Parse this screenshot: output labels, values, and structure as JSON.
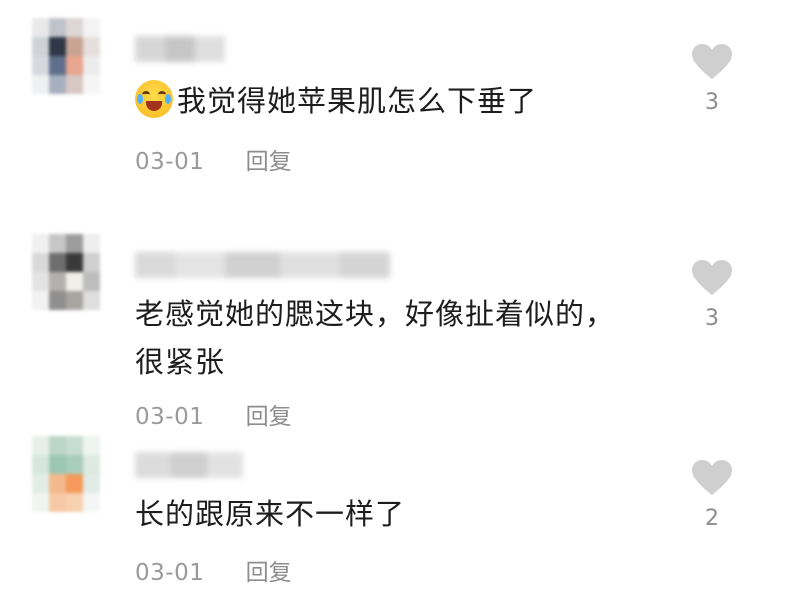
{
  "comments": [
    {
      "text_prefix_emoji": "laughing-crying-emoji",
      "text": "我觉得她苹果肌怎么下垂了",
      "date": "03-01",
      "reply_label": "回复",
      "likes": "3"
    },
    {
      "text": "老感觉她的腮这块，好像扯着似的，",
      "text_line2": "很紧张",
      "date": "03-01",
      "reply_label": "回复",
      "likes": "3"
    },
    {
      "text": "长的跟原来不一样了",
      "date": "03-01",
      "reply_label": "回复",
      "likes": "2"
    }
  ],
  "colors": {
    "like_icon": "#cfcfcf",
    "meta_text": "#9a9a9a",
    "comment_text": "#1d1d1d"
  },
  "icons": {
    "like": "heart-icon"
  }
}
